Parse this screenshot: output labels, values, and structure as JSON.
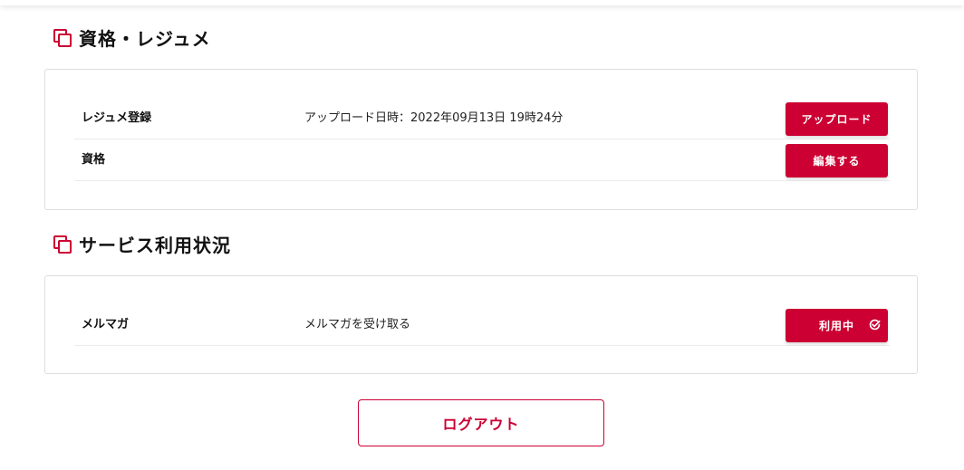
{
  "sections": [
    {
      "title": "資格・レジュメ",
      "icon": "copy-icon",
      "rows": [
        {
          "label": "レジュメ登録",
          "value": "アップロード日時：2022年09月13日 19時24分",
          "button": "アップロード"
        },
        {
          "label": "資格",
          "value": "",
          "button": "編集する"
        }
      ]
    },
    {
      "title": "サービス利用状況",
      "icon": "copy-icon",
      "rows": [
        {
          "label": "メルマガ",
          "value": "メルマガを受け取る",
          "button": "利用中",
          "button_icon": "check-circle-icon"
        }
      ]
    }
  ],
  "logout_label": "ログアウト",
  "colors": {
    "accent": "#cc0033",
    "border": "#dedede",
    "divider": "#ececec",
    "text": "#111111"
  }
}
